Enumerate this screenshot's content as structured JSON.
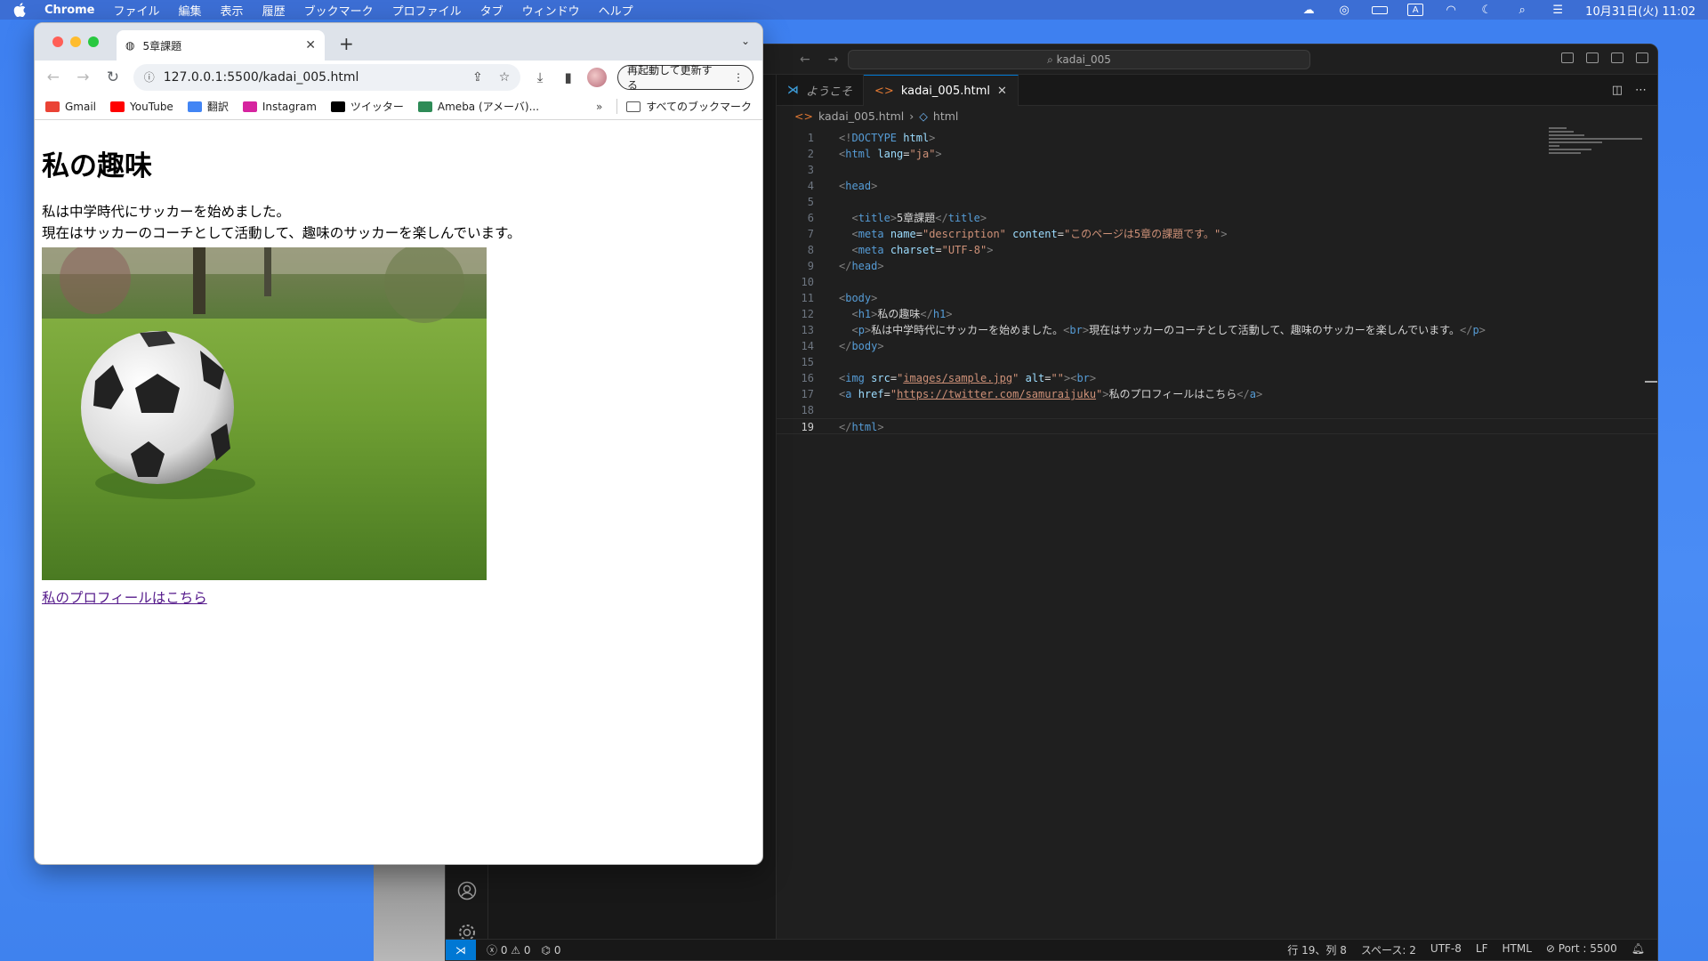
{
  "menubar": {
    "app": "Chrome",
    "items": [
      "ファイル",
      "編集",
      "表示",
      "履歴",
      "ブックマーク",
      "プロファイル",
      "タブ",
      "ウィンドウ",
      "ヘルプ"
    ],
    "input_mode": "A",
    "datetime": "10月31日(火) 11:02"
  },
  "vscode": {
    "search": "kadai_005",
    "tabs": [
      {
        "label": "ようこそ",
        "active": false
      },
      {
        "label": "kadai_005.html",
        "active": true
      }
    ],
    "breadcrumb": {
      "file": "kadai_005.html",
      "symbol": "html"
    },
    "current_line": 19,
    "lines": [
      {
        "n": "1",
        "tokens": [
          [
            "t-br",
            "<!"
          ],
          [
            "t-tag",
            "DOCTYPE"
          ],
          [
            "t-txt",
            " "
          ],
          [
            "t-attr",
            "html"
          ],
          [
            "t-br",
            ">"
          ]
        ]
      },
      {
        "n": "2",
        "tokens": [
          [
            "t-br",
            "<"
          ],
          [
            "t-tag",
            "html"
          ],
          [
            "t-txt",
            " "
          ],
          [
            "t-attr",
            "lang"
          ],
          [
            "t-txt",
            "="
          ],
          [
            "t-str",
            "\"ja\""
          ],
          [
            "t-br",
            ">"
          ]
        ]
      },
      {
        "n": "3",
        "tokens": []
      },
      {
        "n": "4",
        "tokens": [
          [
            "t-br",
            "<"
          ],
          [
            "t-tag",
            "head"
          ],
          [
            "t-br",
            ">"
          ]
        ]
      },
      {
        "n": "5",
        "tokens": []
      },
      {
        "n": "6",
        "tokens": [
          [
            "t-txt",
            "  "
          ],
          [
            "t-br",
            "<"
          ],
          [
            "t-tag",
            "title"
          ],
          [
            "t-br",
            ">"
          ],
          [
            "t-txt",
            "5章課題"
          ],
          [
            "t-br",
            "</"
          ],
          [
            "t-tag",
            "title"
          ],
          [
            "t-br",
            ">"
          ]
        ]
      },
      {
        "n": "7",
        "tokens": [
          [
            "t-txt",
            "  "
          ],
          [
            "t-br",
            "<"
          ],
          [
            "t-tag",
            "meta"
          ],
          [
            "t-txt",
            " "
          ],
          [
            "t-attr",
            "name"
          ],
          [
            "t-txt",
            "="
          ],
          [
            "t-str",
            "\"description\""
          ],
          [
            "t-txt",
            " "
          ],
          [
            "t-attr",
            "content"
          ],
          [
            "t-txt",
            "="
          ],
          [
            "t-str",
            "\"このページは5章の課題です。\""
          ],
          [
            "t-br",
            ">"
          ]
        ]
      },
      {
        "n": "8",
        "tokens": [
          [
            "t-txt",
            "  "
          ],
          [
            "t-br",
            "<"
          ],
          [
            "t-tag",
            "meta"
          ],
          [
            "t-txt",
            " "
          ],
          [
            "t-attr",
            "charset"
          ],
          [
            "t-txt",
            "="
          ],
          [
            "t-str",
            "\"UTF-8\""
          ],
          [
            "t-br",
            ">"
          ]
        ]
      },
      {
        "n": "9",
        "tokens": [
          [
            "t-br",
            "</"
          ],
          [
            "t-tag",
            "head"
          ],
          [
            "t-br",
            ">"
          ]
        ]
      },
      {
        "n": "10",
        "tokens": []
      },
      {
        "n": "11",
        "tokens": [
          [
            "t-br",
            "<"
          ],
          [
            "t-tag",
            "body"
          ],
          [
            "t-br",
            ">"
          ]
        ]
      },
      {
        "n": "12",
        "tokens": [
          [
            "t-txt",
            "  "
          ],
          [
            "t-br",
            "<"
          ],
          [
            "t-tag",
            "h1"
          ],
          [
            "t-br",
            ">"
          ],
          [
            "t-txt",
            "私の趣味"
          ],
          [
            "t-br",
            "</"
          ],
          [
            "t-tag",
            "h1"
          ],
          [
            "t-br",
            ">"
          ]
        ]
      },
      {
        "n": "13",
        "tokens": [
          [
            "t-txt",
            "  "
          ],
          [
            "t-br",
            "<"
          ],
          [
            "t-tag",
            "p"
          ],
          [
            "t-br",
            ">"
          ],
          [
            "t-txt",
            "私は中学時代にサッカーを始めました。"
          ],
          [
            "t-br",
            "<"
          ],
          [
            "t-tag",
            "br"
          ],
          [
            "t-br",
            ">"
          ],
          [
            "t-txt",
            "現在はサッカーのコーチとして活動して、趣味のサッカーを楽しんでいます。"
          ],
          [
            "t-br",
            "</"
          ],
          [
            "t-tag",
            "p"
          ],
          [
            "t-br",
            ">"
          ]
        ]
      },
      {
        "n": "14",
        "tokens": [
          [
            "t-br",
            "</"
          ],
          [
            "t-tag",
            "body"
          ],
          [
            "t-br",
            ">"
          ]
        ]
      },
      {
        "n": "15",
        "tokens": []
      },
      {
        "n": "16",
        "tokens": [
          [
            "t-br",
            "<"
          ],
          [
            "t-tag",
            "img"
          ],
          [
            "t-txt",
            " "
          ],
          [
            "t-attr",
            "src"
          ],
          [
            "t-txt",
            "="
          ],
          [
            "t-str",
            "\""
          ],
          [
            "t-url",
            "images/sample.jpg"
          ],
          [
            "t-str",
            "\""
          ],
          [
            "t-txt",
            " "
          ],
          [
            "t-attr",
            "alt"
          ],
          [
            "t-txt",
            "="
          ],
          [
            "t-str",
            "\"\""
          ],
          [
            "t-br",
            "><"
          ],
          [
            "t-tag",
            "br"
          ],
          [
            "t-br",
            ">"
          ]
        ]
      },
      {
        "n": "17",
        "tokens": [
          [
            "t-br",
            "<"
          ],
          [
            "t-tag",
            "a"
          ],
          [
            "t-txt",
            " "
          ],
          [
            "t-attr",
            "href"
          ],
          [
            "t-txt",
            "="
          ],
          [
            "t-str",
            "\""
          ],
          [
            "t-url",
            "https://twitter.com/samuraijuku"
          ],
          [
            "t-str",
            "\""
          ],
          [
            "t-br",
            ">"
          ],
          [
            "t-txt",
            "私のプロフィールはこちら"
          ],
          [
            "t-br",
            "</"
          ],
          [
            "t-tag",
            "a"
          ],
          [
            "t-br",
            ">"
          ]
        ]
      },
      {
        "n": "18",
        "tokens": []
      },
      {
        "n": "19",
        "tokens": [
          [
            "t-br",
            "</"
          ],
          [
            "t-tag",
            "html"
          ],
          [
            "t-br",
            ">"
          ]
        ]
      }
    ],
    "status": {
      "errors": "0",
      "warnings": "0",
      "ports": "0",
      "position": "行 19、列 8",
      "spaces": "スペース: 2",
      "encoding": "UTF-8",
      "eol": "LF",
      "language": "HTML",
      "port": "Port : 5500"
    }
  },
  "chrome": {
    "tab_title": "5章課題",
    "url": "127.0.0.1:5500/kadai_005.html",
    "reload_button": "再起動して更新する",
    "bookmarks": [
      {
        "label": "Gmail",
        "icon": "gmail-icon",
        "color": "#ea4335"
      },
      {
        "label": "YouTube",
        "icon": "youtube-icon",
        "color": "#ff0000"
      },
      {
        "label": "翻訳",
        "icon": "translate-icon",
        "color": "#4285f4"
      },
      {
        "label": "Instagram",
        "icon": "instagram-icon",
        "color": "#d6249f"
      },
      {
        "label": "ツイッター",
        "icon": "x-icon",
        "color": "#000000"
      },
      {
        "label": "Ameba (アメーバ)...",
        "icon": "ameba-icon",
        "color": "#2e8b57"
      }
    ],
    "all_bookmarks": "すべてのブックマーク"
  },
  "page": {
    "heading": "私の趣味",
    "paragraph_line1": "私は中学時代にサッカーを始めました。",
    "paragraph_line2": "現在はサッカーのコーチとして活動して、趣味のサッカーを楽しんでいます。",
    "link": "私のプロフィールはこちら"
  }
}
